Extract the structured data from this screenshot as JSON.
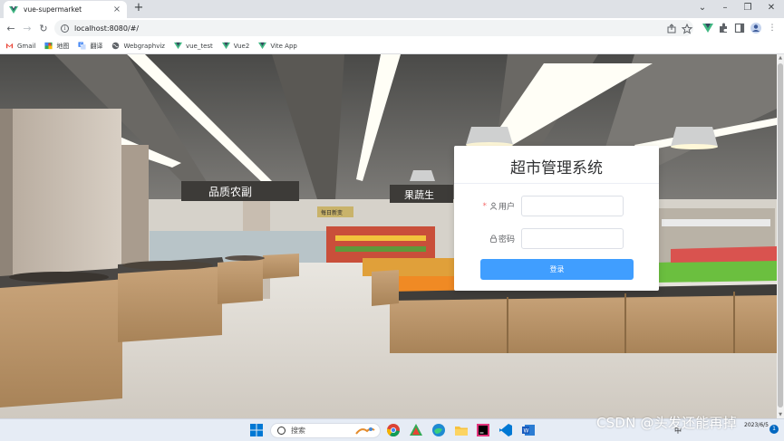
{
  "browser": {
    "tab_title": "vue-supermarket",
    "tab_close": "×",
    "new_tab": "+",
    "url": "localhost:8080/#/",
    "window_controls": [
      "⌄",
      "–",
      "❐",
      "✕"
    ],
    "nav": {
      "back": "←",
      "forward": "→",
      "reload": "↻"
    },
    "bookmarks": [
      {
        "label": "Gmail",
        "icon": "gmail-icon",
        "color": "#ea4335"
      },
      {
        "label": "地图",
        "icon": "maps-icon",
        "color": "#34a853"
      },
      {
        "label": "翻译",
        "icon": "translate-icon",
        "color": "#4285f4"
      },
      {
        "label": "Webgraphviz",
        "icon": "globe-icon",
        "color": "#5f6368"
      },
      {
        "label": "vue_test",
        "icon": "vue-icon",
        "color": "#42b883"
      },
      {
        "label": "Vue2",
        "icon": "vue-icon",
        "color": "#42b883"
      },
      {
        "label": "Vite App",
        "icon": "vue-icon",
        "color": "#42b883"
      }
    ]
  },
  "scene": {
    "signs": [
      "品质农副",
      "果蔬生",
      "每日新变"
    ]
  },
  "login": {
    "title": "超市管理系统",
    "username_label": "用户",
    "required_mark": "*",
    "password_label": "密码",
    "username_value": "",
    "password_value": "",
    "submit_label": "登录",
    "accent_color": "#409eff"
  },
  "taskbar": {
    "search_placeholder": "搜索",
    "clock_time": "",
    "clock_date": "2023/6/5",
    "tray_lang": "中",
    "tray_notify": "1"
  },
  "watermark": "CSDN @头发还能再掉"
}
